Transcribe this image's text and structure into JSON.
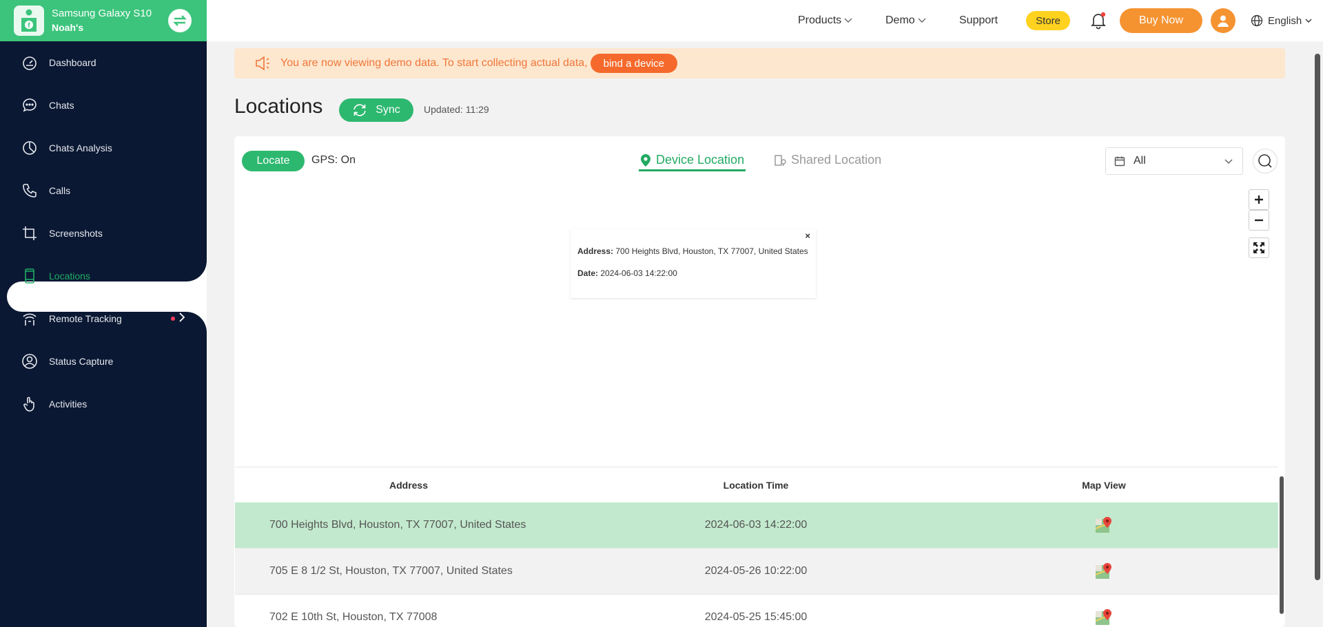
{
  "device": {
    "name": "Samsung Galaxy S10",
    "user": "Noah's"
  },
  "sidebar": {
    "items": [
      {
        "label": "Dashboard",
        "icon": "dashboard-icon"
      },
      {
        "label": "Chats",
        "icon": "chat-bubble-icon"
      },
      {
        "label": "Chats Analysis",
        "icon": "pie-chart-icon"
      },
      {
        "label": "Calls",
        "icon": "phone-icon"
      },
      {
        "label": "Screenshots",
        "icon": "crop-icon"
      },
      {
        "label": "Locations",
        "icon": "phone-device-icon",
        "active": true
      },
      {
        "label": "Remote Tracking",
        "icon": "tracking-icon"
      },
      {
        "label": "Status Capture",
        "icon": "user-circle-icon"
      },
      {
        "label": "Activities",
        "icon": "hand-pointer-icon"
      }
    ]
  },
  "topbar": {
    "products": "Products",
    "demo": "Demo",
    "support": "Support",
    "store": "Store",
    "buy_now": "Buy Now",
    "language": "English"
  },
  "banner": {
    "text": "You are now viewing demo data. To start collecting actual data,",
    "button": "bind a device"
  },
  "page": {
    "title": "Locations",
    "sync": "Sync",
    "updated": "Updated: 11:29"
  },
  "toolbar": {
    "locate": "Locate",
    "gps": "GPS: On",
    "tab_device": "Device Location",
    "tab_shared": "Shared Location",
    "date_filter": "All"
  },
  "popup": {
    "address_label": "Address:",
    "address": "700 Heights Blvd, Houston, TX 77007, United States",
    "date_label": "Date:",
    "date": "2024-06-03 14:22:00",
    "close": "×"
  },
  "table": {
    "headers": {
      "address": "Address",
      "time": "Location Time",
      "map": "Map View"
    },
    "rows": [
      {
        "address": "700 Heights Blvd, Houston, TX 77007, United States",
        "time": "2024-06-03 14:22:00"
      },
      {
        "address": "705 E 8 1/2 St, Houston, TX 77007, United States",
        "time": "2024-05-26 10:22:00"
      },
      {
        "address": "702 E 10th St, Houston, TX 77008",
        "time": "2024-05-25 15:45:00"
      }
    ]
  },
  "colors": {
    "brand_green": "#3cc47c",
    "sidebar_bg": "#0b1833",
    "accent_orange": "#f59331",
    "selected_row": "#c2e9cd"
  }
}
